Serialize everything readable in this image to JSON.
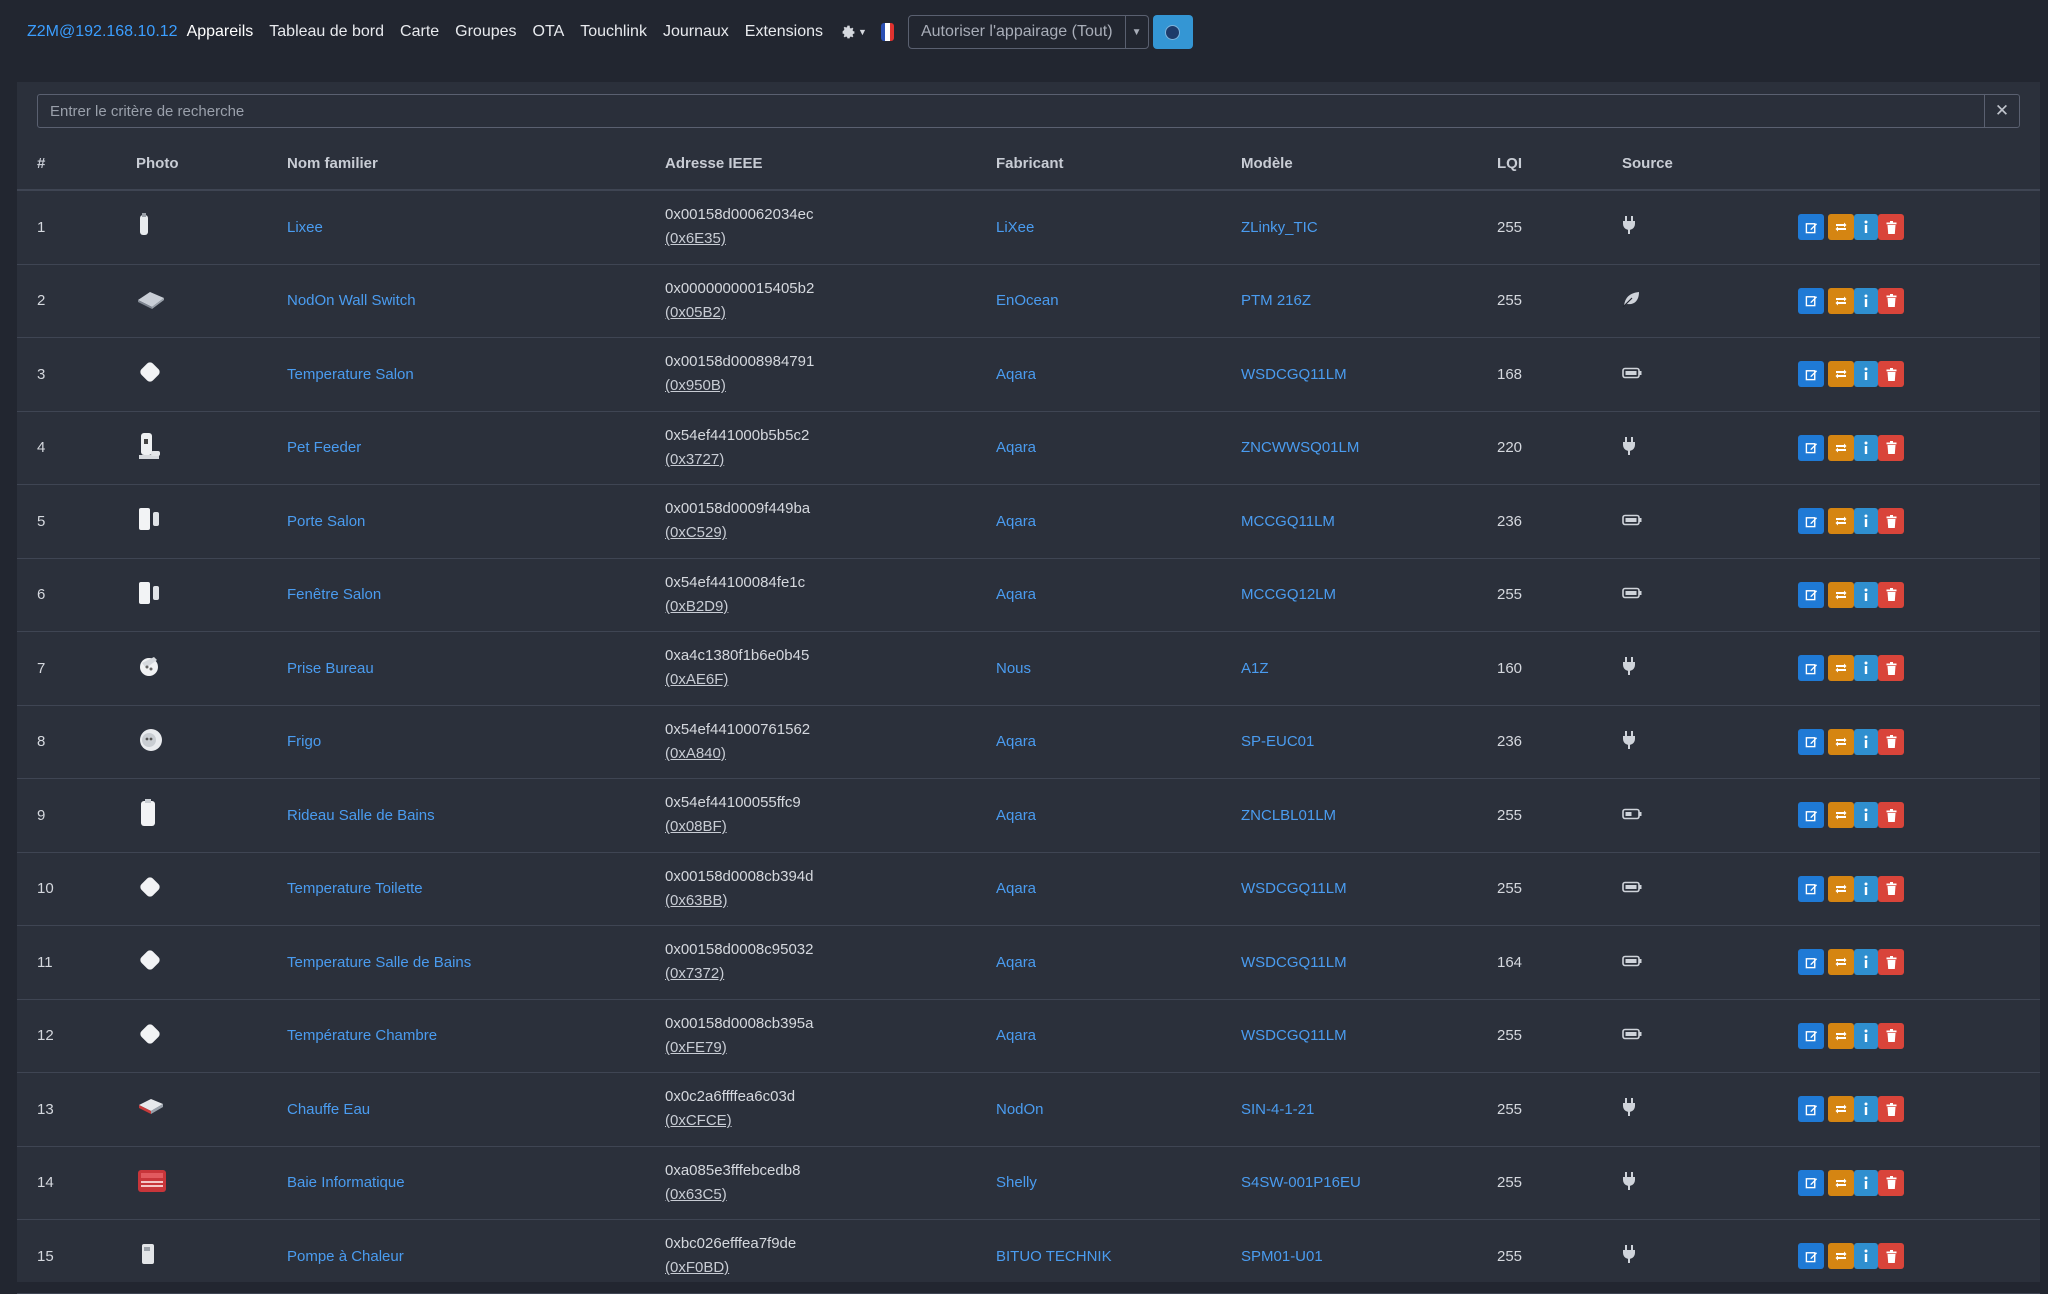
{
  "navbar": {
    "brand": "Z2M@192.168.10.12",
    "links": [
      "Appareils",
      "Tableau de bord",
      "Carte",
      "Groupes",
      "OTA",
      "Touchlink",
      "Journaux",
      "Extensions"
    ],
    "permit_join_label": "Autoriser l'appairage (Tout)"
  },
  "search": {
    "placeholder": "Entrer le critère de recherche",
    "value": ""
  },
  "table": {
    "headers": [
      "#",
      "Photo",
      "Nom familier",
      "Adresse IEEE",
      "Fabricant",
      "Modèle",
      "LQI",
      "Source"
    ],
    "rows": [
      {
        "idx": "1",
        "name": "Lixee",
        "ieee": "0x00158d00062034ec",
        "nwk": "(0x6E35)",
        "vendor": "LiXee",
        "model": "ZLinky_TIC",
        "lqi": "255",
        "source": "mains",
        "photo": "stick"
      },
      {
        "idx": "2",
        "name": "NodOn Wall Switch",
        "ieee": "0x00000000015405b2",
        "nwk": "(0x05B2)",
        "vendor": "EnOcean",
        "model": "PTM 216Z",
        "lqi": "255",
        "source": "leaf",
        "photo": "switch"
      },
      {
        "idx": "3",
        "name": "Temperature Salon",
        "ieee": "0x00158d0008984791",
        "nwk": "(0x950B)",
        "vendor": "Aqara",
        "model": "WSDCGQ11LM",
        "lqi": "168",
        "source": "battery",
        "photo": "diamond"
      },
      {
        "idx": "4",
        "name": "Pet Feeder",
        "ieee": "0x54ef441000b5b5c2",
        "nwk": "(0x3727)",
        "vendor": "Aqara",
        "model": "ZNCWWSQ01LM",
        "lqi": "220",
        "source": "mains",
        "photo": "feeder"
      },
      {
        "idx": "5",
        "name": "Porte Salon",
        "ieee": "0x00158d0009f449ba",
        "nwk": "(0xC529)",
        "vendor": "Aqara",
        "model": "MCCGQ11LM",
        "lqi": "236",
        "source": "battery",
        "photo": "contact"
      },
      {
        "idx": "6",
        "name": "Fenêtre Salon",
        "ieee": "0x54ef44100084fe1c",
        "nwk": "(0xB2D9)",
        "vendor": "Aqara",
        "model": "MCCGQ12LM",
        "lqi": "255",
        "source": "battery",
        "photo": "contact"
      },
      {
        "idx": "7",
        "name": "Prise Bureau",
        "ieee": "0xa4c1380f1b6e0b45",
        "nwk": "(0xAE6F)",
        "vendor": "Nous",
        "model": "A1Z",
        "lqi": "160",
        "source": "mains",
        "photo": "plug"
      },
      {
        "idx": "8",
        "name": "Frigo",
        "ieee": "0x54ef441000761562",
        "nwk": "(0xA840)",
        "vendor": "Aqara",
        "model": "SP-EUC01",
        "lqi": "236",
        "source": "mains",
        "photo": "round-plug"
      },
      {
        "idx": "9",
        "name": "Rideau Salle de Bains",
        "ieee": "0x54ef44100055ffc9",
        "nwk": "(0x08BF)",
        "vendor": "Aqara",
        "model": "ZNCLBL01LM",
        "lqi": "255",
        "source": "battery-half",
        "photo": "motor"
      },
      {
        "idx": "10",
        "name": "Temperature Toilette",
        "ieee": "0x00158d0008cb394d",
        "nwk": "(0x63BB)",
        "vendor": "Aqara",
        "model": "WSDCGQ11LM",
        "lqi": "255",
        "source": "battery",
        "photo": "diamond"
      },
      {
        "idx": "11",
        "name": "Temperature Salle de Bains",
        "ieee": "0x00158d0008c95032",
        "nwk": "(0x7372)",
        "vendor": "Aqara",
        "model": "WSDCGQ11LM",
        "lqi": "164",
        "source": "battery",
        "photo": "diamond"
      },
      {
        "idx": "12",
        "name": "Température Chambre",
        "ieee": "0x00158d0008cb395a",
        "nwk": "(0xFE79)",
        "vendor": "Aqara",
        "model": "WSDCGQ11LM",
        "lqi": "255",
        "source": "battery",
        "photo": "diamond"
      },
      {
        "idx": "13",
        "name": "Chauffe Eau",
        "ieee": "0x0c2a6ffffea6c03d",
        "nwk": "(0xCFCE)",
        "vendor": "NodOn",
        "model": "SIN-4-1-21",
        "lqi": "255",
        "source": "mains",
        "photo": "module"
      },
      {
        "idx": "14",
        "name": "Baie Informatique",
        "ieee": "0xa085e3fffebcedb8",
        "nwk": "(0x63C5)",
        "vendor": "Shelly",
        "model": "S4SW-001P16EU",
        "lqi": "255",
        "source": "mains",
        "photo": "shelly"
      },
      {
        "idx": "15",
        "name": "Pompe à Chaleur",
        "ieee": "0xbc026efffea7f9de",
        "nwk": "(0xF0BD)",
        "vendor": "BITUO TECHNIK",
        "model": "SPM01-U01",
        "lqi": "255",
        "source": "mains",
        "photo": "meter"
      }
    ]
  }
}
